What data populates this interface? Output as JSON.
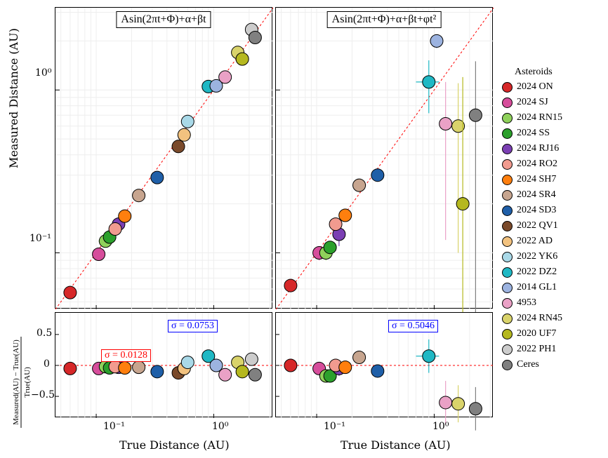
{
  "chart_data": {
    "type": "scatter",
    "layout": "2x2 (2 columns share x-axis; top row = scatter log-log with 1:1 line + error bars; bottom row = residuals)",
    "titles": {
      "top_left": "Asin(2πt+Φ)+α+βt",
      "top_right": "Asin(2πt+Φ)+α+βt+φt²"
    },
    "axes": {
      "x_label": "True Distance (AU)",
      "y_label_top": "Measured Distance (AU)",
      "y_label_bottom": "Measured(AU) − True(AU) / True(AU)",
      "x_scale": "log",
      "y_scale_top": "log",
      "x_ticks": [
        "10⁻¹",
        "10⁰"
      ],
      "y_ticks_top": [
        "10⁻¹",
        "10⁰"
      ],
      "y_ticks_bottom": [
        -0.5,
        0,
        0.5
      ]
    },
    "sigma_annotations": {
      "bottom_left_red": {
        "label": "σ = 0.0128",
        "color": "red"
      },
      "bottom_left_blue": {
        "label": "σ = 0.0753",
        "color": "blue"
      },
      "bottom_right_blue": {
        "label": "σ = 0.5046",
        "color": "blue"
      }
    },
    "legend_title": "Asteroids",
    "series": [
      {
        "name": "2024 ON",
        "color": "#d62728",
        "true": 0.06,
        "meas_left": 0.057,
        "xerr_left": 0.006,
        "yerr_left": 0.0008,
        "res_left": -0.05,
        "meas_right": 0.063,
        "xerr_right": 0.006,
        "yerr_right": 0.003,
        "res_right": 0.0,
        "rerr_left": 0.02,
        "rerr_right": 0.05
      },
      {
        "name": "2024 SJ",
        "color": "#d64d9b",
        "true": 0.105,
        "meas_left": 0.098,
        "xerr_left": 0.01,
        "yerr_left": 0.002,
        "res_left": -0.05,
        "meas_right": 0.1,
        "xerr_right": 0.01,
        "yerr_right": 0.01,
        "res_right": -0.05,
        "rerr_left": 0.02,
        "rerr_right": 0.1
      },
      {
        "name": "2024 RN15",
        "color": "#8fd15b",
        "true": 0.12,
        "meas_left": 0.118,
        "xerr_left": 0.015,
        "yerr_left": 0.002,
        "res_left": -0.02,
        "meas_right": 0.1,
        "xerr_right": 0.015,
        "yerr_right": 0.01,
        "res_right": -0.17,
        "rerr_left": 0.04,
        "rerr_right": 0.1
      },
      {
        "name": "2024 SS",
        "color": "#2ca02c",
        "true": 0.13,
        "meas_left": 0.125,
        "xerr_left": 0.013,
        "yerr_left": 0.002,
        "res_left": -0.04,
        "meas_right": 0.108,
        "xerr_right": 0.013,
        "yerr_right": 0.01,
        "res_right": -0.17,
        "rerr_left": 0.02,
        "rerr_right": 0.1
      },
      {
        "name": "2024 RJ16",
        "color": "#7b3fb3",
        "true": 0.155,
        "meas_left": 0.15,
        "xerr_left": 0.015,
        "yerr_left": 0.003,
        "res_left": -0.03,
        "meas_right": 0.13,
        "xerr_right": 0.015,
        "yerr_right": 0.02,
        "res_right": -0.05,
        "rerr_left": 0.02,
        "rerr_right": 0.12
      },
      {
        "name": "2024 RO2",
        "color": "#f19b8f",
        "true": 0.145,
        "meas_left": 0.14,
        "xerr_left": 0.015,
        "yerr_left": 0.003,
        "res_left": -0.02,
        "meas_right": 0.15,
        "xerr_right": 0.015,
        "yerr_right": 0.01,
        "res_right": 0.0,
        "rerr_left": 0.02,
        "rerr_right": 0.07
      },
      {
        "name": "2024 SH7",
        "color": "#ff7f0e",
        "true": 0.175,
        "meas_left": 0.168,
        "xerr_left": 0.017,
        "yerr_left": 0.003,
        "res_left": -0.04,
        "meas_right": 0.17,
        "xerr_right": 0.017,
        "yerr_right": 0.012,
        "res_right": -0.03,
        "rerr_left": 0.02,
        "rerr_right": 0.07
      },
      {
        "name": "2024 SR4",
        "color": "#c7a58f",
        "true": 0.23,
        "meas_left": 0.225,
        "xerr_left": 0.02,
        "yerr_left": 0.005,
        "res_left": -0.03,
        "meas_right": 0.26,
        "xerr_right": 0.02,
        "yerr_right": 0.025,
        "res_right": 0.13,
        "rerr_left": 0.02,
        "rerr_right": 0.1
      },
      {
        "name": "2024 SD3",
        "color": "#1f5fa8",
        "true": 0.33,
        "meas_left": 0.29,
        "xerr_left": 0.03,
        "yerr_left": 0.005,
        "res_left": -0.1,
        "meas_right": 0.3,
        "xerr_right": 0.03,
        "yerr_right": 0.02,
        "res_right": -0.09,
        "rerr_left": 0.02,
        "rerr_right": 0.07
      },
      {
        "name": "2022 QV1",
        "color": "#7a4a2b",
        "true": 0.5,
        "meas_left": 0.45,
        "xerr_left": 0.05,
        "yerr_left": 0.01,
        "res_left": -0.12,
        "meas_right": null,
        "xerr_right": null,
        "yerr_right": null,
        "res_right": null,
        "rerr_left": 0.02,
        "rerr_right": null
      },
      {
        "name": "2022 AD",
        "color": "#f2c27f",
        "true": 0.56,
        "meas_left": 0.53,
        "xerr_left": 0.055,
        "yerr_left": 0.015,
        "res_left": -0.05,
        "meas_right": null,
        "xerr_right": null,
        "yerr_right": null,
        "res_right": null,
        "rerr_left": 0.02,
        "rerr_right": null
      },
      {
        "name": "2022 YK6",
        "color": "#a9d9e8",
        "true": 0.6,
        "meas_left": 0.64,
        "xerr_left": 0.06,
        "yerr_left": 0.02,
        "res_left": 0.05,
        "meas_right": null,
        "xerr_right": null,
        "yerr_right": null,
        "res_right": null,
        "rerr_left": 0.04,
        "rerr_right": null
      },
      {
        "name": "2022 DZ2",
        "color": "#1fb8c4",
        "true": 0.9,
        "meas_left": 1.05,
        "xerr_left": 0.09,
        "yerr_left": 0.03,
        "res_left": 0.15,
        "meas_right": 1.12,
        "xerr_right": 0.2,
        "yerr_right": 0.4,
        "res_right": 0.15,
        "rerr_left": 0.05,
        "rerr_right": 0.27
      },
      {
        "name": "2014 GL1",
        "color": "#9cb3e0",
        "true": 1.05,
        "meas_left": 1.06,
        "xerr_left": 0.1,
        "yerr_left": 0.025,
        "res_left": 0.0,
        "meas_right": 2.0,
        "xerr_right": 0.1,
        "yerr_right": 0.2,
        "res_right": null,
        "rerr_left": 0.03,
        "rerr_right": null
      },
      {
        "name": "4953",
        "color": "#eaa1c6",
        "true": 1.25,
        "meas_left": 1.2,
        "xerr_left": 0.12,
        "yerr_left": 0.03,
        "res_left": -0.15,
        "meas_right": 0.62,
        "xerr_right": 0.12,
        "yerr_right": 0.5,
        "res_right": -0.6,
        "rerr_left": 0.03,
        "rerr_right": 0.35
      },
      {
        "name": "2024 RN45",
        "color": "#d9d36b",
        "true": 1.6,
        "meas_left": 1.7,
        "xerr_left": 0.16,
        "yerr_left": 0.05,
        "res_left": 0.05,
        "meas_right": 0.6,
        "xerr_right": 0.16,
        "yerr_right": 0.5,
        "res_right": -0.62,
        "rerr_left": 0.03,
        "rerr_right": 0.3
      },
      {
        "name": "2020 UF7",
        "color": "#b5b81f",
        "true": 1.75,
        "meas_left": 1.55,
        "xerr_left": 0.175,
        "yerr_left": 0.04,
        "res_left": -0.1,
        "meas_right": 0.2,
        "xerr_right": 0.175,
        "yerr_right": 1.0,
        "res_right": null,
        "rerr_left": 0.03,
        "rerr_right": null
      },
      {
        "name": "2022 PH1",
        "color": "#cccccc",
        "true": 2.1,
        "meas_left": 2.35,
        "xerr_left": 0.21,
        "yerr_left": 0.07,
        "res_left": 0.1,
        "meas_right": null,
        "xerr_right": null,
        "yerr_right": null,
        "res_right": null,
        "rerr_left": 0.04,
        "rerr_right": null
      },
      {
        "name": "Ceres",
        "color": "#808080",
        "true": 2.25,
        "meas_left": 2.1,
        "xerr_left": 0.225,
        "yerr_left": 0.07,
        "res_left": -0.15,
        "meas_right": 0.7,
        "xerr_right": 0.225,
        "yerr_right": 0.8,
        "res_right": -0.7,
        "rerr_left": 0.03,
        "rerr_right": 0.35
      }
    ]
  }
}
